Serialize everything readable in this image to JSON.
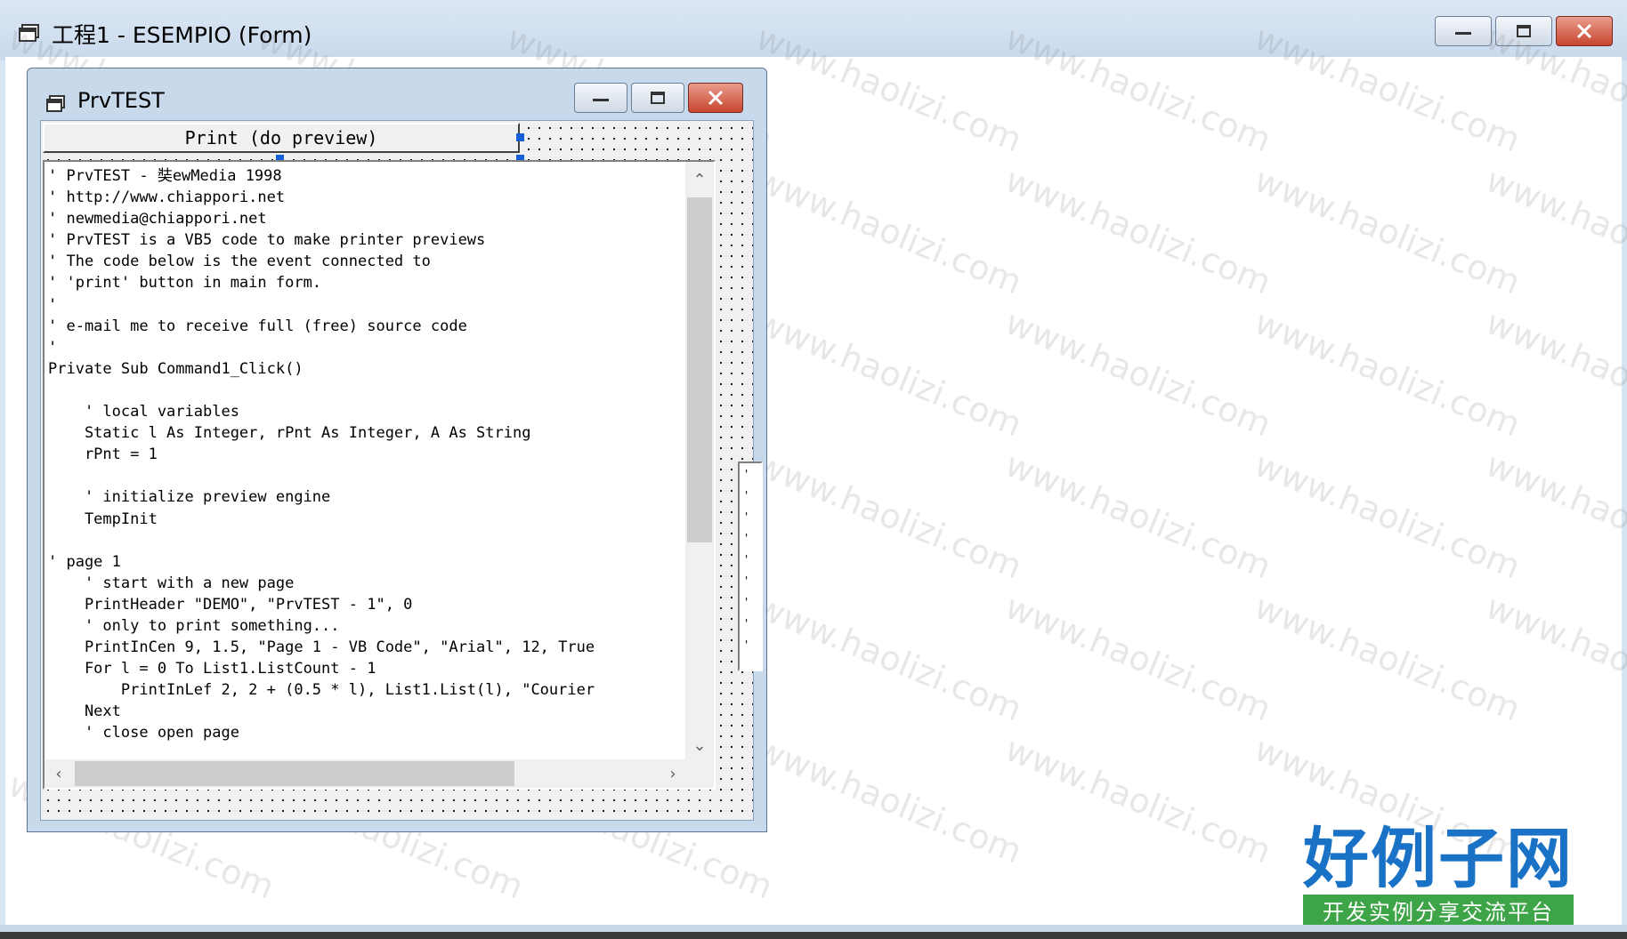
{
  "window": {
    "title": "工程1 - ESEMPIO (Form)"
  },
  "form": {
    "title": "PrvTEST",
    "print_button_label": "Print (do preview)",
    "code_lines": [
      "' PrvTEST - 奘ewMedia 1998",
      "' http://www.chiappori.net",
      "' newmedia@chiappori.net",
      "' PrvTEST is a VB5 code to make printer previews",
      "' The code below is the event connected to",
      "' 'print' button in main form.",
      "'",
      "' e-mail me to receive full (free) source code",
      "'",
      "Private Sub Command1_Click()",
      "",
      "    ' local variables",
      "    Static l As Integer, rPnt As Integer, A As String",
      "    rPnt = 1",
      "",
      "    ' initialize preview engine",
      "    TempInit",
      "",
      "' page 1",
      "    ' start with a new page",
      "    PrintHeader \"DEMO\", \"PrvTEST - 1\", 0",
      "    ' only to print something...",
      "    PrintInCen 9, 1.5, \"Page 1 - VB Code\", \"Arial\", 12, True",
      "    For l = 0 To List1.ListCount - 1",
      "        PrintInLef 2, 2 + (0.5 * l), List1.List(l), \"Courier",
      "    Next",
      "    ' close open page"
    ],
    "list_lines": [
      "'",
      "'",
      "'",
      "'",
      "'",
      "'",
      "'",
      "'",
      "'"
    ]
  },
  "watermark": {
    "text": "www.haolizi.com",
    "logo_title": "好例子网",
    "logo_subtitle": "开发实例分享交流平台"
  },
  "icons": {
    "window_icon": "form-window-icon",
    "minimize": "minimize-icon",
    "maximize": "maximize-icon",
    "close": "close-icon",
    "scroll_up": "chevron-up-icon",
    "scroll_down": "chevron-down-icon",
    "scroll_left": "chevron-left-icon",
    "scroll_right": "chevron-right-icon"
  },
  "colors": {
    "selection_handle": "#1560d8",
    "close_button": "#c8452f",
    "logo_blue": "#1a72c6",
    "logo_green": "#3da447"
  }
}
